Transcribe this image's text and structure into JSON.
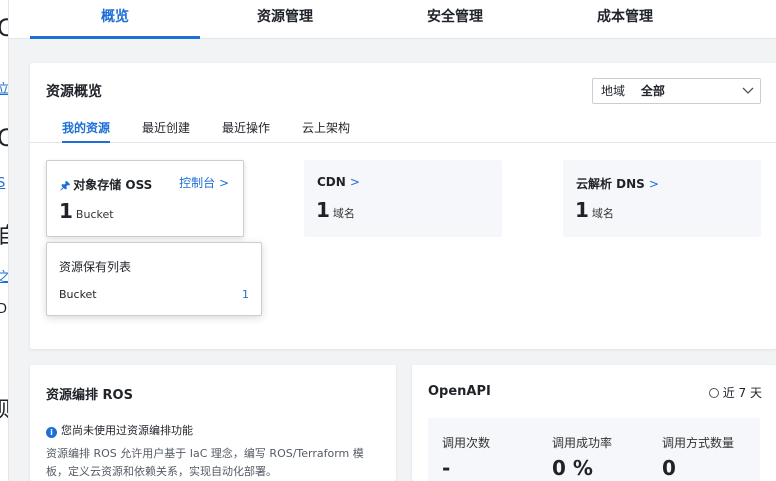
{
  "left_strip": [
    "C",
    "立",
    "C",
    "S",
    "自",
    "之",
    "D",
    "则"
  ],
  "top_tabs": [
    "概览",
    "资源管理",
    "安全管理",
    "成本管理"
  ],
  "overview": {
    "title": "资源概览",
    "region": {
      "label": "地域",
      "value": "全部"
    },
    "sub_tabs": [
      "我的资源",
      "最近创建",
      "最近操作",
      "云上架构"
    ],
    "resources": [
      {
        "name": "对象存储 OSS",
        "count": "1",
        "unit": "Bucket",
        "link": "控制台",
        "arrow": ">"
      },
      {
        "name": "CDN",
        "count": "1",
        "unit": "域名",
        "arrow": ">"
      },
      {
        "name": "云解析 DNS",
        "count": "1",
        "unit": "域名",
        "arrow": ">"
      }
    ],
    "popover": {
      "title": "资源保有列表",
      "row_label": "Bucket",
      "row_value": "1"
    }
  },
  "ros": {
    "title": "资源编排 ROS",
    "info": "您尚未使用过资源编排功能",
    "desc": "资源编排 ROS 允许用户基于 IaC 理念，编写 ROS/Terraform 模板，定义云资源和依赖关系，实现自动化部署。"
  },
  "openapi": {
    "title": "OpenAPI",
    "period": "近 7 天",
    "metrics": [
      {
        "label": "调用次数",
        "value": "-"
      },
      {
        "label": "调用成功率",
        "value": "0 %"
      },
      {
        "label": "调用方式数量",
        "value": "0"
      }
    ]
  },
  "colors": {
    "accent": "#1d6fd6",
    "background": "#f2f3f5",
    "card": "#ffffff"
  }
}
